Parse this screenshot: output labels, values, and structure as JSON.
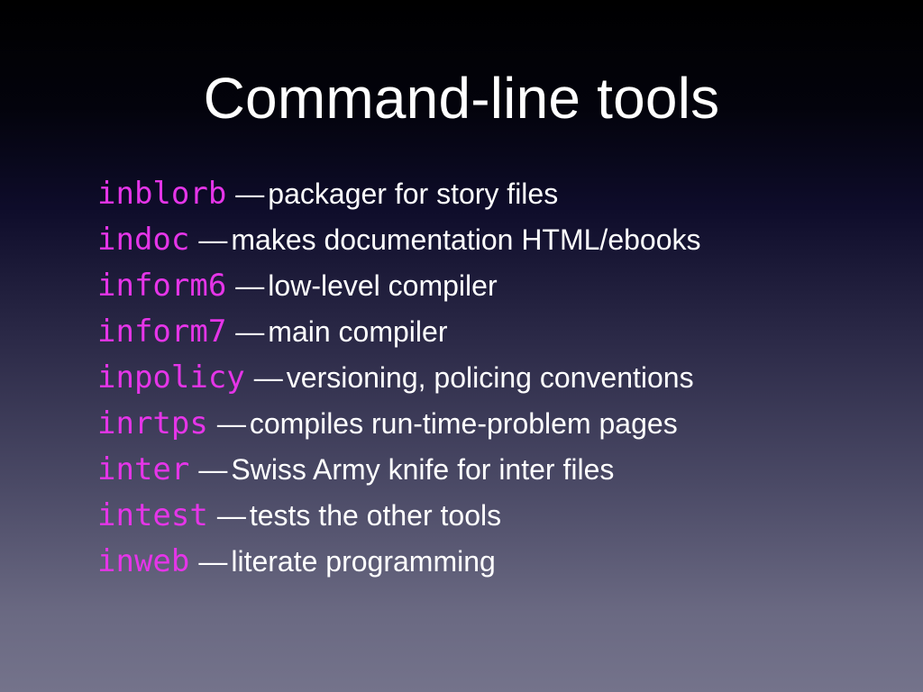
{
  "title": "Command-line tools",
  "colors": {
    "tool_name": "#e535e8",
    "text": "#ffffff",
    "background_top": "#000000",
    "background_bottom": "#74738b"
  },
  "tools": [
    {
      "name": "inblorb",
      "separator": "—",
      "description": "packager for story files"
    },
    {
      "name": "indoc",
      "separator": "—",
      "description": "makes documentation HTML/ebooks"
    },
    {
      "name": "inform6",
      "separator": "—",
      "description": "low-level compiler"
    },
    {
      "name": "inform7",
      "separator": "—",
      "description": "main compiler"
    },
    {
      "name": "inpolicy",
      "separator": "—",
      "description": "versioning, policing conventions"
    },
    {
      "name": "inrtps",
      "separator": "—",
      "description": "compiles run-time-problem pages"
    },
    {
      "name": "inter",
      "separator": "—",
      "description": "Swiss Army knife for inter files"
    },
    {
      "name": "intest",
      "separator": "—",
      "description": "tests the other tools"
    },
    {
      "name": "inweb",
      "separator": "—",
      "description": "literate programming"
    }
  ]
}
